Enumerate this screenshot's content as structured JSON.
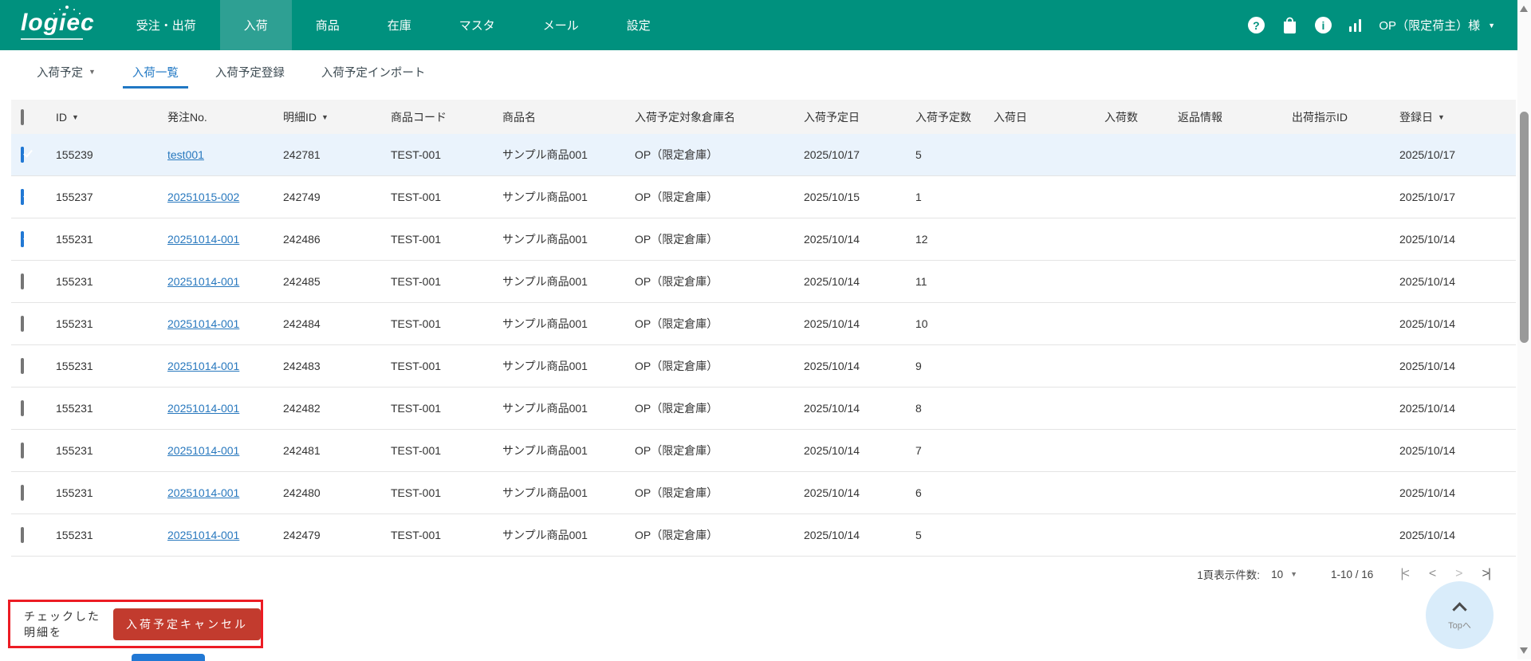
{
  "colors": {
    "accent_teal": "#00917e",
    "accent_teal_active": "#2ea093",
    "tab_blue": "#2178c4",
    "link_blue": "#2878be",
    "checkbox_blue": "#2178d4",
    "highlight_row": "#eaf3fc",
    "annotation_red": "#ec1c24",
    "button_red": "#c23b2e",
    "circle_blue": "#d9ecfa"
  },
  "glyphs": {
    "help": "?",
    "info": "i",
    "caret_down": "▼",
    "sort_desc": "▼",
    "first_page": "|<",
    "prev_page": "<",
    "next_page": ">",
    "last_page": ">|"
  },
  "brand": {
    "logo_text": "logiec"
  },
  "navbar": {
    "items": [
      {
        "label": "受注・出荷",
        "active": false
      },
      {
        "label": "入荷",
        "active": true
      },
      {
        "label": "商品",
        "active": false
      },
      {
        "label": "在庫",
        "active": false
      },
      {
        "label": "マスタ",
        "active": false
      },
      {
        "label": "メール",
        "active": false
      },
      {
        "label": "設定",
        "active": false
      }
    ],
    "user_label": "OP（限定荷主）様"
  },
  "tabs": [
    {
      "label": "入荷予定",
      "active": false,
      "dropdown": true
    },
    {
      "label": "入荷一覧",
      "active": true
    },
    {
      "label": "入荷予定登録",
      "active": false
    },
    {
      "label": "入荷予定インポート",
      "active": false
    }
  ],
  "table": {
    "columns": [
      {
        "label": "ID",
        "sort": true
      },
      {
        "label": "発注No."
      },
      {
        "label": "明細ID",
        "sort": true
      },
      {
        "label": "商品コード"
      },
      {
        "label": "商品名"
      },
      {
        "label": "入荷予定対象倉庫名"
      },
      {
        "label": "入荷予定日"
      },
      {
        "label": "入荷予定数"
      },
      {
        "label": "入荷日"
      },
      {
        "label": "入荷数"
      },
      {
        "label": "返品情報"
      },
      {
        "label": "出荷指示ID"
      },
      {
        "label": "登録日",
        "sort": true
      }
    ],
    "rows": [
      {
        "checked": true,
        "highlight": true,
        "id": "155239",
        "order_no": "test001",
        "detail_id": "242781",
        "product_code": "TEST-001",
        "product_name": "サンプル商品001",
        "warehouse": "OP（限定倉庫）",
        "expected_date": "2025/10/17",
        "expected_qty": "5",
        "arrival_date": "",
        "arrival_qty": "",
        "return_info": "",
        "shipping_id": "",
        "registered": "2025/10/17"
      },
      {
        "checked": true,
        "highlight": false,
        "id": "155237",
        "order_no": "20251015-002",
        "detail_id": "242749",
        "product_code": "TEST-001",
        "product_name": "サンプル商品001",
        "warehouse": "OP（限定倉庫）",
        "expected_date": "2025/10/15",
        "expected_qty": "1",
        "arrival_date": "",
        "arrival_qty": "",
        "return_info": "",
        "shipping_id": "",
        "registered": "2025/10/17"
      },
      {
        "checked": true,
        "highlight": false,
        "id": "155231",
        "order_no": "20251014-001",
        "detail_id": "242486",
        "product_code": "TEST-001",
        "product_name": "サンプル商品001",
        "warehouse": "OP（限定倉庫）",
        "expected_date": "2025/10/14",
        "expected_qty": "12",
        "arrival_date": "",
        "arrival_qty": "",
        "return_info": "",
        "shipping_id": "",
        "registered": "2025/10/14"
      },
      {
        "checked": false,
        "highlight": false,
        "id": "155231",
        "order_no": "20251014-001",
        "detail_id": "242485",
        "product_code": "TEST-001",
        "product_name": "サンプル商品001",
        "warehouse": "OP（限定倉庫）",
        "expected_date": "2025/10/14",
        "expected_qty": "11",
        "arrival_date": "",
        "arrival_qty": "",
        "return_info": "",
        "shipping_id": "",
        "registered": "2025/10/14"
      },
      {
        "checked": false,
        "highlight": false,
        "id": "155231",
        "order_no": "20251014-001",
        "detail_id": "242484",
        "product_code": "TEST-001",
        "product_name": "サンプル商品001",
        "warehouse": "OP（限定倉庫）",
        "expected_date": "2025/10/14",
        "expected_qty": "10",
        "arrival_date": "",
        "arrival_qty": "",
        "return_info": "",
        "shipping_id": "",
        "registered": "2025/10/14"
      },
      {
        "checked": false,
        "highlight": false,
        "id": "155231",
        "order_no": "20251014-001",
        "detail_id": "242483",
        "product_code": "TEST-001",
        "product_name": "サンプル商品001",
        "warehouse": "OP（限定倉庫）",
        "expected_date": "2025/10/14",
        "expected_qty": "9",
        "arrival_date": "",
        "arrival_qty": "",
        "return_info": "",
        "shipping_id": "",
        "registered": "2025/10/14"
      },
      {
        "checked": false,
        "highlight": false,
        "id": "155231",
        "order_no": "20251014-001",
        "detail_id": "242482",
        "product_code": "TEST-001",
        "product_name": "サンプル商品001",
        "warehouse": "OP（限定倉庫）",
        "expected_date": "2025/10/14",
        "expected_qty": "8",
        "arrival_date": "",
        "arrival_qty": "",
        "return_info": "",
        "shipping_id": "",
        "registered": "2025/10/14"
      },
      {
        "checked": false,
        "highlight": false,
        "id": "155231",
        "order_no": "20251014-001",
        "detail_id": "242481",
        "product_code": "TEST-001",
        "product_name": "サンプル商品001",
        "warehouse": "OP（限定倉庫）",
        "expected_date": "2025/10/14",
        "expected_qty": "7",
        "arrival_date": "",
        "arrival_qty": "",
        "return_info": "",
        "shipping_id": "",
        "registered": "2025/10/14"
      },
      {
        "checked": false,
        "highlight": false,
        "id": "155231",
        "order_no": "20251014-001",
        "detail_id": "242480",
        "product_code": "TEST-001",
        "product_name": "サンプル商品001",
        "warehouse": "OP（限定倉庫）",
        "expected_date": "2025/10/14",
        "expected_qty": "6",
        "arrival_date": "",
        "arrival_qty": "",
        "return_info": "",
        "shipping_id": "",
        "registered": "2025/10/14"
      },
      {
        "checked": false,
        "highlight": false,
        "id": "155231",
        "order_no": "20251014-001",
        "detail_id": "242479",
        "product_code": "TEST-001",
        "product_name": "サンプル商品001",
        "warehouse": "OP（限定倉庫）",
        "expected_date": "2025/10/14",
        "expected_qty": "5",
        "arrival_date": "",
        "arrival_qty": "",
        "return_info": "",
        "shipping_id": "",
        "registered": "2025/10/14"
      }
    ]
  },
  "pagination": {
    "per_page_label": "1頁表示件数:",
    "per_page_value": "10",
    "range_label": "1-10 / 16"
  },
  "footer_action": {
    "label": "チェックした明細を",
    "button_label": "入荷予定キャンセル"
  },
  "back_to_top": {
    "label": "Topへ"
  }
}
